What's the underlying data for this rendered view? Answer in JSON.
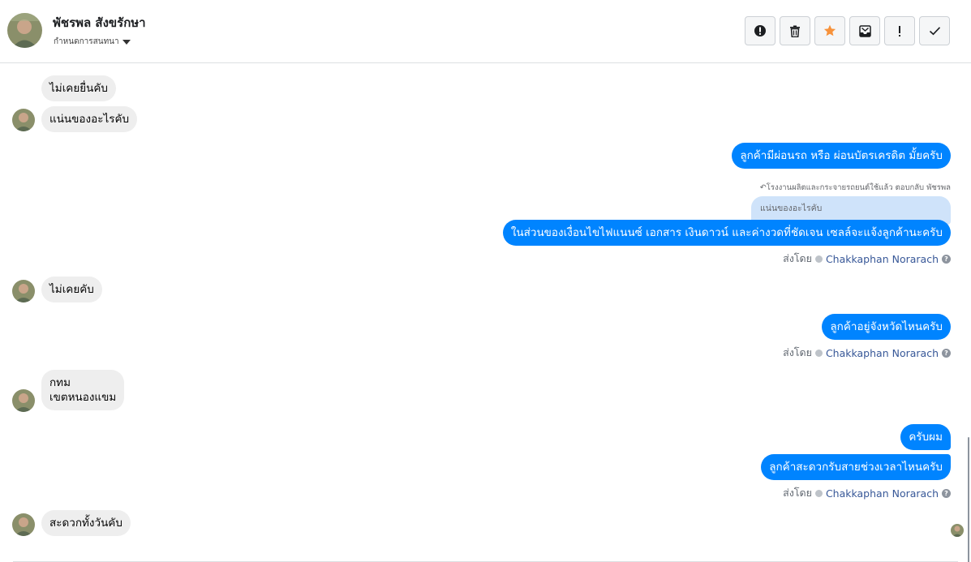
{
  "header": {
    "contact_name": "พัชรพล สังขรักษา",
    "label_dropdown": "กำหนดการสนทนา",
    "toolbar": [
      {
        "icon": "alert-circle-icon",
        "name": "mark-spam-button"
      },
      {
        "icon": "trash-icon",
        "name": "delete-button"
      },
      {
        "icon": "star-icon",
        "name": "star-button"
      },
      {
        "icon": "archive-icon",
        "name": "archive-button"
      },
      {
        "icon": "exclamation-icon",
        "name": "follow-up-button"
      },
      {
        "icon": "check-icon",
        "name": "mark-done-button"
      }
    ],
    "star_color": "#f7923b"
  },
  "messages": {
    "m1": "ไม่เคยยื่นคับ",
    "m2": "แน่นของอะไรคับ",
    "m3": "ลูกค้ามีผ่อนรถ หรือ ผ่อนบัตรเครดิต มั้ยครับ",
    "m4_note": "↶โรงงานผลิตและกระจายรถยนต์ใช้แล้ว ตอบกลับ พัชรพล",
    "m4_quote": "แน่นของอะไรคับ",
    "m4": "ในส่วนของเงื่อนไขไฟแนนซ์ เอกสาร เงินดาวน์ และค่างวดที่ชัดเจน เซลล์จะแจ้งลูกค้านะครับ",
    "sent_by_1": "ส่งโดย",
    "agent_1": "Chakkaphan Norarach",
    "m5": "ไม่เคยคับ",
    "m6": "ลูกค้าอยู่จังหวัดไหนครับ",
    "sent_by_2": "ส่งโดย",
    "agent_2": "Chakkaphan Norarach",
    "m7_line1": "กทม",
    "m7_line2": "เขตหนองแขม",
    "m8": "ครับผม",
    "m9": "ลูกค้าสะดวกรับสายช่วงเวลาไหนครับ",
    "sent_by_3": "ส่งโดย",
    "agent_3": "Chakkaphan Norarach",
    "m10": "สะดวกทั้งวันคับ",
    "help_glyph": "?"
  },
  "colors": {
    "outgoing_bubble": "#0084ff",
    "incoming_bubble": "#eeeeee",
    "agent_link": "#385898"
  }
}
